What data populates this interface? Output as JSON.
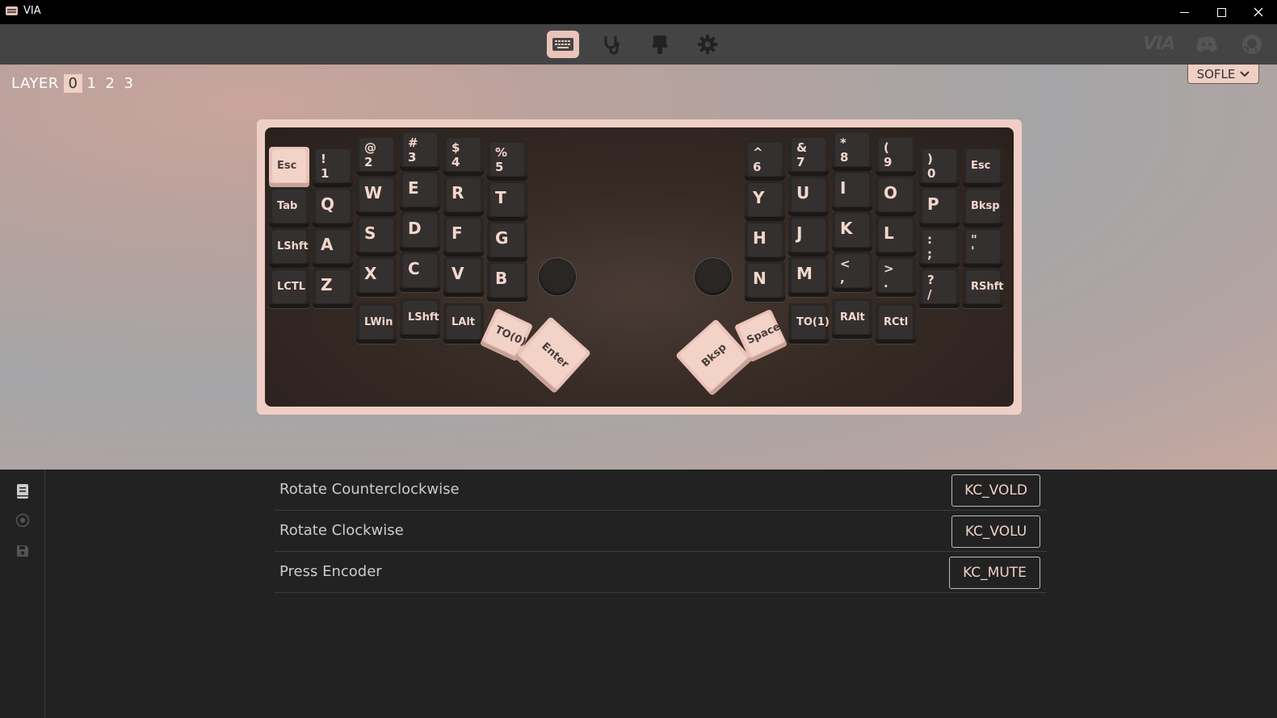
{
  "window": {
    "title": "VIA"
  },
  "nav": {
    "icons": [
      "keyboard-icon",
      "stethoscope-icon",
      "brush-icon",
      "gear-icon"
    ],
    "right_logo": "VIA",
    "right_icons": [
      "discord-icon",
      "github-icon"
    ]
  },
  "layers": {
    "label": "LAYER",
    "items": [
      "0",
      "1",
      "2",
      "3"
    ],
    "active": "0"
  },
  "keyboard_select": {
    "value": "SOFLE"
  },
  "keys": {
    "esc_l": "Esc",
    "k1_top": "!",
    "k1_bot": "1",
    "k2_top": "@",
    "k2_bot": "2",
    "k3_top": "#",
    "k3_bot": "3",
    "k4_top": "$",
    "k4_bot": "4",
    "k5_top": "%",
    "k5_bot": "5",
    "tab": "Tab",
    "q": "Q",
    "w": "W",
    "e": "E",
    "r": "R",
    "t": "T",
    "lshft": "LShft",
    "a": "A",
    "s": "S",
    "d": "D",
    "f": "F",
    "g": "G",
    "lctl": "LCTL",
    "z": "Z",
    "x": "X",
    "c": "C",
    "v": "V",
    "b": "B",
    "lwin": "LWin",
    "lshft2": "LShft",
    "lalt": "LAlt",
    "to0": "TO(0)",
    "enter": "Enter",
    "k6_top": "^",
    "k6_bot": "6",
    "k7_top": "&",
    "k7_bot": "7",
    "k8_top": "*",
    "k8_bot": "8",
    "k9_top": "(",
    "k9_bot": "9",
    "k0_top": ")",
    "k0_bot": "0",
    "esc_r": "Esc",
    "y": "Y",
    "u": "U",
    "i": "I",
    "o": "O",
    "p": "P",
    "bksp_r": "Bksp",
    "h": "H",
    "j": "J",
    "k": "K",
    "l": "L",
    "semi_top": ":",
    "semi_bot": ";",
    "quote_top": "\"",
    "quote_bot": "'",
    "n": "N",
    "m": "M",
    "comma_top": "<",
    "comma_bot": ",",
    "dot_top": ">",
    "dot_bot": ".",
    "slash_top": "?",
    "slash_bot": "/",
    "rshft": "RShft",
    "to1": "TO(1)",
    "ralt": "RAlt",
    "rctl": "RCtl",
    "bksp_thumb": "Bksp",
    "space": "Space"
  },
  "encoder": {
    "rows": [
      {
        "label": "Rotate Counterclockwise",
        "value": "KC_VOLD"
      },
      {
        "label": "Rotate Clockwise",
        "value": "KC_VOLU"
      },
      {
        "label": "Press Encoder",
        "value": "KC_MUTE"
      }
    ]
  },
  "sidebar": {
    "icons": [
      "keymap-icon",
      "encoder-icon",
      "save-icon"
    ]
  },
  "colors": {
    "accent": "#f0cfc5",
    "keycap_dark": "#353030",
    "bg_dark": "#222222"
  }
}
